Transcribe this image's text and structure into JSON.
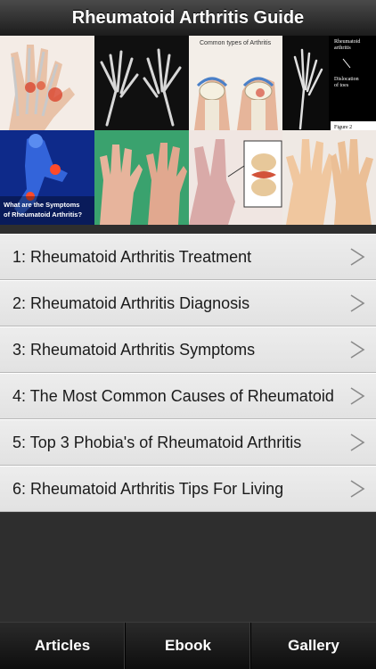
{
  "navbar": {
    "title": "Rheumatoid Arthritis Guide"
  },
  "banner": {
    "tiles": [
      {
        "icon": "hand-xray-illustration"
      },
      {
        "icon": "hands-xray"
      },
      {
        "icon": "knee-diagram",
        "caption": "Common types of Arthritis"
      },
      {
        "icon": "foot-xray",
        "caption_lines": [
          "Rheumatoid",
          "arthritis",
          "Dislocation",
          "of toes",
          "Figure 2"
        ]
      },
      {
        "icon": "symptoms-figure",
        "caption_lines": [
          "What are the Symptoms",
          "of Rheumatoid Arthritis?"
        ]
      },
      {
        "icon": "swollen-hands-photo"
      },
      {
        "icon": "joint-closeup-illustration"
      },
      {
        "icon": "hands-photo"
      }
    ]
  },
  "menu": {
    "items": [
      {
        "label": "1: Rheumatoid Arthritis Treatment"
      },
      {
        "label": "2: Rheumatoid Arthritis Diagnosis"
      },
      {
        "label": "3: Rheumatoid Arthritis Symptoms"
      },
      {
        "label": "4: The Most Common Causes of Rheumatoid"
      },
      {
        "label": "5: Top 3 Phobia's of Rheumatoid Arthritis"
      },
      {
        "label": "6: Rheumatoid Arthritis Tips For Living"
      }
    ],
    "chevron_icon": "chevron-right-icon"
  },
  "tabbar": {
    "tabs": [
      {
        "label": "Articles"
      },
      {
        "label": "Ebook"
      },
      {
        "label": "Gallery"
      }
    ]
  }
}
